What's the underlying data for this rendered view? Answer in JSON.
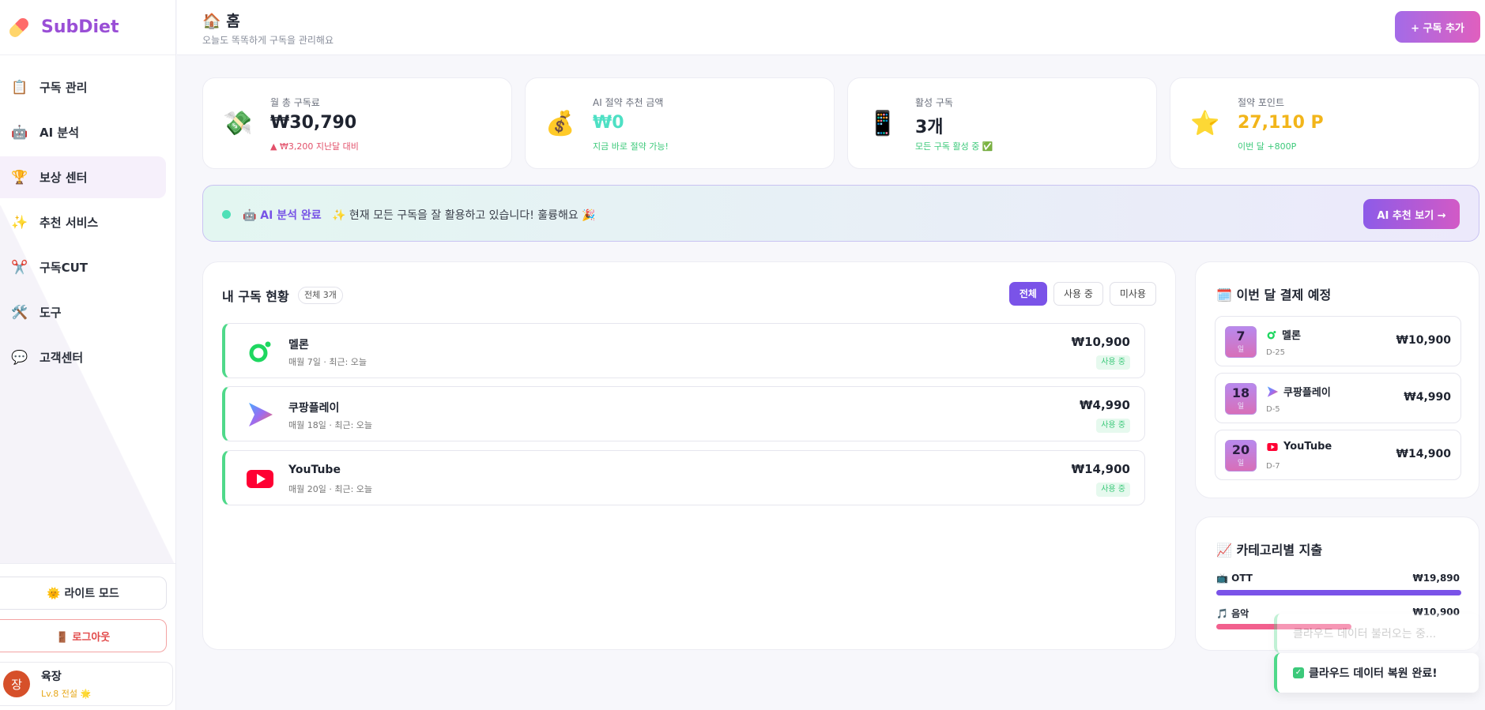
{
  "brand": {
    "name": "SubDiet"
  },
  "nav": [
    {
      "label": "구독 관리",
      "icon": "📋"
    },
    {
      "label": "AI 분석",
      "icon": "🤖"
    },
    {
      "label": "보상 센터",
      "icon": "🏆"
    },
    {
      "label": "추천 서비스",
      "icon": "✨"
    },
    {
      "label": "구독CUT",
      "icon": "✂️"
    },
    {
      "label": "도구",
      "icon": "🛠️"
    },
    {
      "label": "고객센터",
      "icon": "💬"
    }
  ],
  "sidebar_bottom": {
    "theme_label": "🌞 라이트 모드",
    "logout_label": "🚪 로그아웃"
  },
  "user": {
    "avatar": "장",
    "name": "육장",
    "level": "Lv.8 전설 🌟"
  },
  "header": {
    "title": "🏠 홈",
    "subtitle": "오늘도 똑똑하게 구독을 관리해요",
    "add_button": "+ 구독 추가"
  },
  "stats": [
    {
      "icon": "💸",
      "label": "월 총 구독료",
      "value": "₩30,790",
      "sub": "▲ ₩3,200 지난달 대비",
      "value_color": "#1f2430",
      "sub_color": "#e2506a"
    },
    {
      "icon": "💰",
      "label": "AI 절약 추천 금액",
      "value": "₩0",
      "sub": "지금 바로 절약 가능!",
      "value_color": "#4ee0c4",
      "sub_color": "#3cc97a"
    },
    {
      "icon": "📱",
      "label": "활성 구독",
      "value": "3개",
      "sub": "모든 구독 활성 중 ✅",
      "value_color": "#1f2430",
      "sub_color": "#3cc97a"
    },
    {
      "icon": "⭐",
      "label": "절약 포인트",
      "value": "27,110 P",
      "sub": "이번 달 +800P",
      "value_color": "#f2b51a",
      "sub_color": "#3cc97a"
    }
  ],
  "banner": {
    "status": "🤖 AI 분석 완료",
    "message": "✨ 현재 모든 구독을 잘 활용하고 있습니다! 훌륭해요 🎉",
    "button": "AI 추천 보기 →"
  },
  "subscriptions": {
    "title": "내 구독 현황",
    "count": "전체 3개",
    "filters": [
      "전체",
      "사용 중",
      "미사용"
    ],
    "items": [
      {
        "name": "멜론",
        "meta": "매월 7일 · 최근: 오늘",
        "price": "₩10,900",
        "status": "사용 중",
        "icon": "melon-icon"
      },
      {
        "name": "쿠팡플레이",
        "meta": "매월 18일 · 최근: 오늘",
        "price": "₩4,990",
        "status": "사용 중",
        "icon": "coupang-play-icon"
      },
      {
        "name": "YouTube",
        "meta": "매월 20일 · 최근: 오늘",
        "price": "₩14,900",
        "status": "사용 중",
        "icon": "youtube-icon"
      }
    ]
  },
  "schedule": {
    "title": "🗓️ 이번 달 결제 예정",
    "items": [
      {
        "day": "7",
        "unit": "일",
        "name": "멜론",
        "dday": "D-25",
        "price": "₩10,900"
      },
      {
        "day": "18",
        "unit": "일",
        "name": "쿠팡플레이",
        "dday": "D-5",
        "price": "₩4,990"
      },
      {
        "day": "20",
        "unit": "일",
        "name": "YouTube",
        "dday": "D-7",
        "price": "₩14,900"
      }
    ]
  },
  "category": {
    "title": "📈 카테고리별 지출",
    "items": [
      {
        "label": "📺 OTT",
        "value": "₩19,890",
        "fraction": 1.0,
        "color": "#7a53e8"
      },
      {
        "label": "🎵 음악",
        "value": "₩10,900",
        "fraction": 0.55,
        "color": "#f2608e"
      }
    ]
  },
  "toasts": {
    "loading": "클라우드 데이터 불러오는 중...",
    "done": "클라우드 데이터 복원 완료!"
  }
}
